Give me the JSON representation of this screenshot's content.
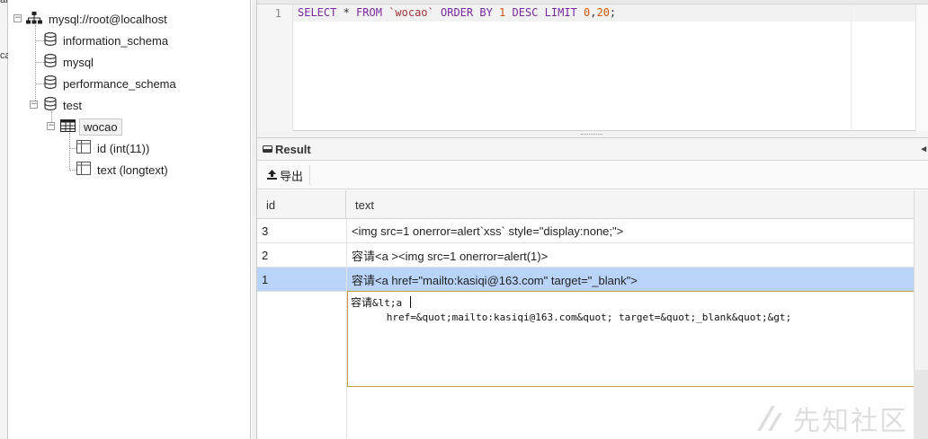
{
  "left_sliver": {
    "fragment_top": "ar",
    "fragment_mid": "ca"
  },
  "tree": {
    "connection": "mysql://root@localhost",
    "databases": [
      {
        "name": "information_schema"
      },
      {
        "name": "mysql"
      },
      {
        "name": "performance_schema"
      },
      {
        "name": "test"
      }
    ],
    "table": {
      "name": "wocao"
    },
    "columns": [
      {
        "label": "id (int(11))"
      },
      {
        "label": "text (longtext)"
      }
    ]
  },
  "editor": {
    "line_number": "1",
    "tokens": {
      "select": "SELECT",
      "star": " * ",
      "from": "FROM",
      "table": "`wocao`",
      "order_by": "ORDER BY",
      "one": "1",
      "desc": "DESC",
      "limit": "LIMIT",
      "offset": "0",
      "comma": ",",
      "count": "20",
      "semicolon": ";"
    }
  },
  "result": {
    "title": "Result",
    "export_label": "导出",
    "columns": [
      "id",
      "text"
    ],
    "rows": [
      {
        "id": "3",
        "text": "<img src=1 onerror=alert`xss` style=\"display:none;\">"
      },
      {
        "id": "2",
        "text": "容请<a ><img src=1 onerror=alert(1)>"
      },
      {
        "id": "1",
        "text": "容请<a href=\"mailto:kasiqi@163.com\" target=\"_blank\">"
      }
    ],
    "cell_editor": {
      "prefix": "容请",
      "line1": "&lt;a ",
      "line2": "      href=&quot;mailto:kasiqi@163.com&quot; target=&quot;_blank&quot;&gt;"
    }
  },
  "watermark": {
    "text": "先知社区"
  },
  "colors": {
    "selected_row": "#b9d4f8",
    "keyword": "#7a28a0",
    "string": "#a03232",
    "number": "#d25a0a",
    "editor_border": "#c8a040"
  },
  "icons": {
    "connection": "network-tree-icon",
    "database": "database-icon",
    "table": "table-icon",
    "column": "column-icon",
    "result": "result-icon",
    "export": "upload-icon",
    "collapse": "chevron-left-icon"
  }
}
